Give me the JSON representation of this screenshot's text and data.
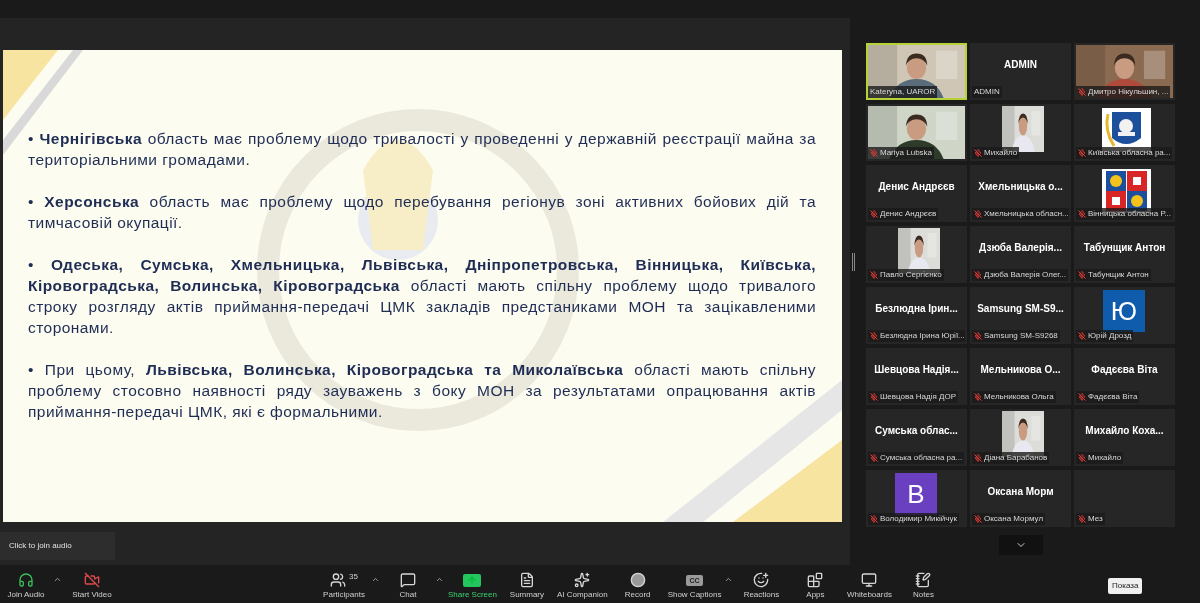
{
  "slide": {
    "bullets": [
      {
        "marker": "•",
        "text": "**Чернігівська** область має проблему щодо тривалості у проведенні у державній реєстрації майна за територіальними громадами."
      },
      {
        "marker": "•",
        "text": "**Херсонська** область має проблему щодо перебування регіонув зоні активних бойових дій та тимчасовій окупації."
      },
      {
        "marker": "•",
        "text": "**Одеська, Сумська, Хмельницька, Львівська, Дніпропетровська, Вінницька, Київська, Кіровоградська, Волинська, Кіровоградська** області мають спільну проблему щодо тривалого строку розгляду актів приймання-передачі ЦМК закладів предстаниками МОН та зацікавленими сторонами."
      },
      {
        "marker": "•",
        "text": "При цьому, **Львівська, Волинська, Кіровоградська та Миколаївська** області мають спільну проблему стосовно наявності ряду зауважень з боку МОН за результатами опрацювання актів приймання-передачі ЦМК, які є формальними."
      }
    ]
  },
  "participants": [
    {
      "kind": "video",
      "label": "Kateryna, UAROR",
      "muted": false,
      "active": true
    },
    {
      "kind": "name",
      "display": "ADMIN",
      "label": "ADMIN",
      "muted": false,
      "active": false
    },
    {
      "kind": "video",
      "label": "Дмитро Нікульшин, ...",
      "muted": true,
      "active": false
    },
    {
      "kind": "video",
      "label": "Mariya Lubska",
      "muted": true,
      "active": false
    },
    {
      "kind": "inset_video",
      "label": "Михайло",
      "muted": true,
      "active": false
    },
    {
      "kind": "emblem",
      "label": "Київська обласна ра...",
      "muted": true,
      "active": false
    },
    {
      "kind": "name",
      "display": "Денис Андрєєв",
      "label": "Денис Андрєєв",
      "muted": true,
      "active": false
    },
    {
      "kind": "name",
      "display": "Хмельницька о...",
      "label": "Хмельницька обласн...",
      "muted": true,
      "active": false
    },
    {
      "kind": "emblem",
      "label": "Вінницька обласна Р...",
      "muted": true,
      "active": false
    },
    {
      "kind": "inset_video",
      "label": "Павло Сергієнко",
      "muted": true,
      "active": false
    },
    {
      "kind": "name",
      "display": "Дзюба Валерія...",
      "label": "Дзюба Валерія Олег...",
      "muted": true,
      "active": false
    },
    {
      "kind": "name",
      "display": "Табунщик Антон",
      "label": "Табунщик Антон",
      "muted": true,
      "active": false
    },
    {
      "kind": "name",
      "display": "Безлюдна Ірин...",
      "label": "Безлюдна Ірина Юрії...",
      "muted": true,
      "active": false
    },
    {
      "kind": "name",
      "display": "Samsung SM-S9...",
      "label": "Samsung SM-S9268",
      "muted": true,
      "active": false
    },
    {
      "kind": "letter",
      "letter": "Ю",
      "color": "#0f5cad",
      "label": "Юрій Дрозд",
      "muted": true,
      "active": false
    },
    {
      "kind": "name",
      "display": "Шевцова Надія...",
      "label": "Шевцова Надія ДОР",
      "muted": true,
      "active": false
    },
    {
      "kind": "name",
      "display": "Мельникова О...",
      "label": "Мельникова Ольга",
      "muted": true,
      "active": false
    },
    {
      "kind": "name",
      "display": "Фадєєва Віта",
      "label": "Фадєєва Віта",
      "muted": true,
      "active": false
    },
    {
      "kind": "name",
      "display": "Сумська облас...",
      "label": "Сумська обласна ра...",
      "muted": true,
      "active": false
    },
    {
      "kind": "inset_video",
      "label": "Діана Барабанов",
      "muted": true,
      "active": false
    },
    {
      "kind": "name",
      "display": "Михайло Коха...",
      "label": "Михайло",
      "muted": true,
      "active": false
    },
    {
      "kind": "letter",
      "letter": "В",
      "color": "#6a3fc0",
      "label": "Володимир Микійчук",
      "muted": true,
      "active": false
    },
    {
      "kind": "name",
      "display": "Оксана Морм",
      "label": "Оксана Мормул",
      "muted": true,
      "active": false
    },
    {
      "kind": "blank",
      "label": "Мез",
      "muted": true,
      "active": false
    }
  ],
  "audio_tooltip": "Click to join audio",
  "toolbar": [
    {
      "kind": "audio",
      "label": "Join Audio",
      "caret": true,
      "accent": false
    },
    {
      "kind": "video_off",
      "label": "Start Video",
      "caret": false,
      "accent": false
    },
    {
      "kind": "participants",
      "label": "Participants",
      "count": "35",
      "caret": true,
      "accent": false
    },
    {
      "kind": "chat",
      "label": "Chat",
      "caret": true,
      "accent": false
    },
    {
      "kind": "share",
      "label": "Share Screen",
      "caret": false,
      "accent": true
    },
    {
      "kind": "summary",
      "label": "Summary",
      "caret": false,
      "accent": false
    },
    {
      "kind": "ai",
      "label": "AI Companion",
      "caret": false,
      "accent": false
    },
    {
      "kind": "record",
      "label": "Record",
      "caret": false,
      "accent": false
    },
    {
      "kind": "captions",
      "label": "Show Captions",
      "badge": "CC",
      "caret": true,
      "accent": false
    },
    {
      "kind": "reactions",
      "label": "Reactions",
      "caret": false,
      "accent": false
    },
    {
      "kind": "apps",
      "label": "Apps",
      "caret": false,
      "accent": false
    },
    {
      "kind": "whiteboards",
      "label": "Whiteboards",
      "caret": false,
      "accent": false
    },
    {
      "kind": "notes",
      "label": "Notes",
      "caret": false,
      "accent": false
    }
  ],
  "desktop_tooltip": "Показа"
}
